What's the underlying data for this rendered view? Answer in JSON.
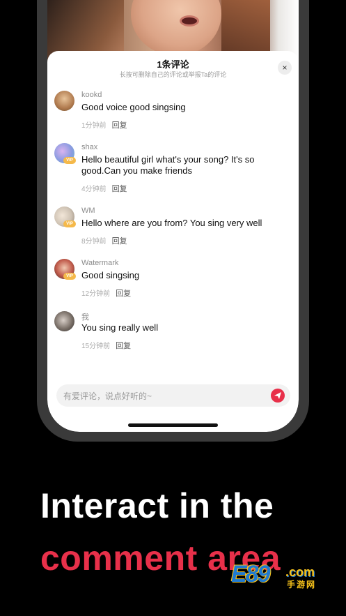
{
  "sheet": {
    "title": "1条评论",
    "subtitle": "长按可删除自己的评论或举报Ta的评论",
    "close_icon": "×"
  },
  "comments": [
    {
      "user": "kookd",
      "text": "Good voice good singsing",
      "time": "1分钟前",
      "reply": "回复",
      "vip": false,
      "avatar_color": "#b07a4e"
    },
    {
      "user": "shax",
      "text": "Hello beautiful girl what's your song? It's so good.Can you make friends",
      "time": "4分钟前",
      "reply": "回复",
      "vip": true,
      "avatar_color": "#8a9be0"
    },
    {
      "user": "WM",
      "text": "Hello where are you from? You sing very well",
      "time": "8分钟前",
      "reply": "回复",
      "vip": true,
      "avatar_color": "#cfc3b4"
    },
    {
      "user": "Watermark",
      "text": "Good singsing",
      "time": "12分钟前",
      "reply": "回复",
      "vip": true,
      "avatar_color": "#c05a4a"
    },
    {
      "user": "我",
      "text": "You sing really well",
      "time": "15分钟前",
      "reply": "回复",
      "vip": false,
      "avatar_color": "#7a7068"
    }
  ],
  "vip_label": "VIP",
  "input": {
    "placeholder": "有爱评论，说点好听的~"
  },
  "headline": {
    "line1": "Interact in the",
    "line2": "comment area"
  },
  "watermark": {
    "num": "E89",
    "com": ".com",
    "cn": "手游网"
  },
  "colors": {
    "accent": "#e8304a",
    "background": "#000000"
  }
}
